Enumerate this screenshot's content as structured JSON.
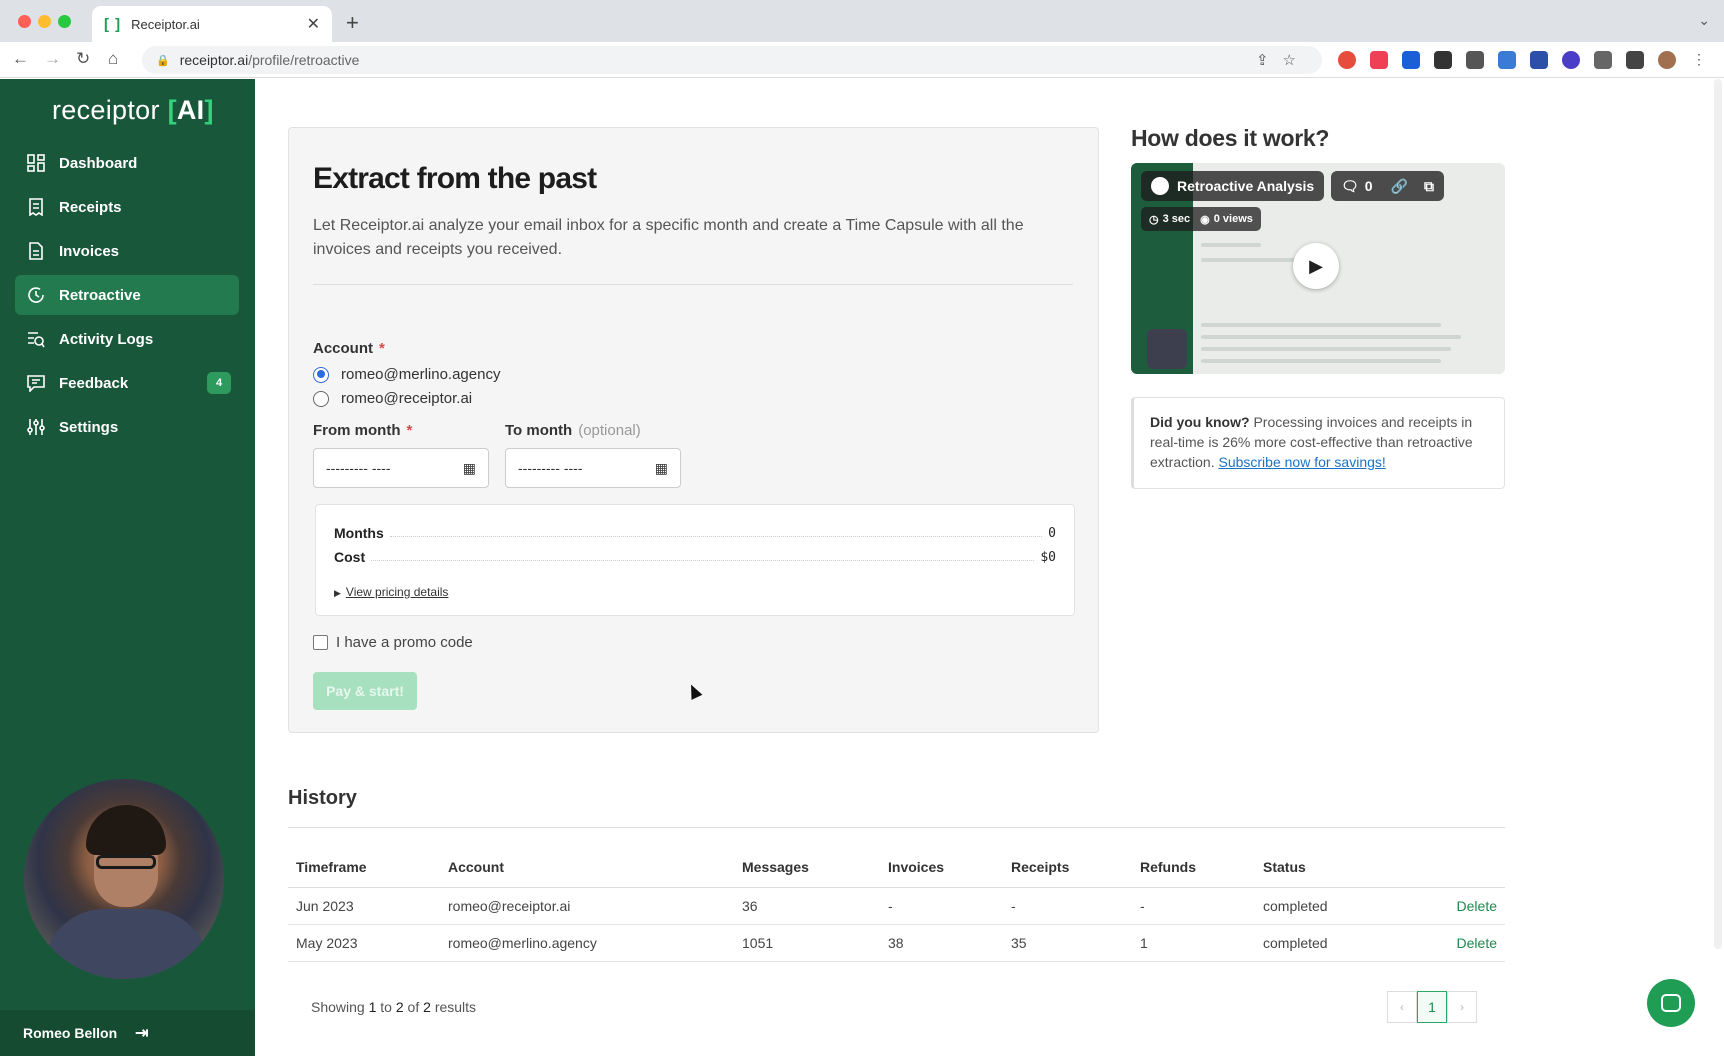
{
  "browser": {
    "tab_title": "Receiptor.ai",
    "url_host": "receiptor.ai",
    "url_path": "/profile/retroactive",
    "new_tab": "+",
    "tab_close": "✕"
  },
  "sidebar": {
    "logo": {
      "word": "receiptor",
      "ai": "AI"
    },
    "items": [
      {
        "label": "Dashboard",
        "icon": "dashboard-icon"
      },
      {
        "label": "Receipts",
        "icon": "receipt-icon"
      },
      {
        "label": "Invoices",
        "icon": "invoice-icon"
      },
      {
        "label": "Retroactive",
        "icon": "retroactive-icon"
      },
      {
        "label": "Activity Logs",
        "icon": "activity-logs-icon"
      },
      {
        "label": "Feedback",
        "icon": "feedback-icon",
        "badge": "4"
      },
      {
        "label": "Settings",
        "icon": "settings-icon"
      }
    ],
    "active_item": "Retroactive",
    "user_name": "Romeo Bellon"
  },
  "extract": {
    "title": "Extract from the past",
    "intro": "Let Receiptor.ai analyze your email inbox for a specific month and create a Time Capsule with all the invoices and receipts you received.",
    "account_label": "Account",
    "required_mark": "*",
    "accounts": [
      {
        "email": "romeo@merlino.agency",
        "selected": true
      },
      {
        "email": "romeo@receiptor.ai",
        "selected": false
      }
    ],
    "from_label": "From month",
    "to_label": "To month",
    "to_optional": "(optional)",
    "date_placeholder": "--------- ----",
    "summary": {
      "months_label": "Months",
      "months_value": "0",
      "cost_label": "Cost",
      "cost_value": "$0",
      "pricing_link": "View pricing details"
    },
    "promo_label": "I have a promo code",
    "pay_button": "Pay & start!"
  },
  "how": {
    "title": "How does it work?",
    "video_title": "Retroactive Analysis",
    "comments": "0",
    "duration": "3 sec",
    "views": "0 views"
  },
  "did_you_know": {
    "lead": "Did you know?",
    "text": " Processing invoices and receipts in real-time is 26% more cost-effective than retroactive extraction. ",
    "link": "Subscribe now for savings!"
  },
  "history": {
    "title": "History",
    "columns": [
      "Timeframe",
      "Account",
      "Messages",
      "Invoices",
      "Receipts",
      "Refunds",
      "Status"
    ],
    "rows": [
      {
        "timeframe": "Jun 2023",
        "account": "romeo@receiptor.ai",
        "messages": "36",
        "invoices": "-",
        "receipts": "-",
        "refunds": "-",
        "status": "completed",
        "action": "Delete"
      },
      {
        "timeframe": "May 2023",
        "account": "romeo@merlino.agency",
        "messages": "1051",
        "invoices": "38",
        "receipts": "35",
        "refunds": "1",
        "status": "completed",
        "action": "Delete"
      }
    ],
    "showing_prefix": "Showing",
    "showing_from": "1",
    "showing_to_word": "to",
    "showing_to": "2",
    "showing_of_word": "of",
    "showing_total": "2",
    "showing_suffix": "results",
    "page_prev": "‹",
    "page_current": "1",
    "page_next": "›"
  },
  "colors": {
    "sidebar": "#19573a",
    "accent": "#1f9d55",
    "active_nav": "#237a4e",
    "pay_button_disabled": "#a6e0bf"
  }
}
